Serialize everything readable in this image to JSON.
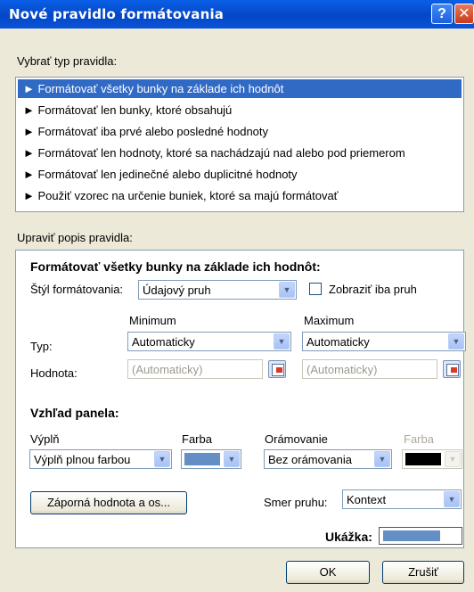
{
  "dialog": {
    "title": "Nové pravidlo formátovania",
    "help_glyph": "?",
    "close_glyph": "✕"
  },
  "rule_type": {
    "label": "Vybrať typ pravidla:",
    "items": [
      {
        "label": "► Formátovať všetky bunky na základe ich hodnôt",
        "selected": true
      },
      {
        "label": "► Formátovať len bunky, ktoré obsahujú",
        "selected": false
      },
      {
        "label": "► Formátovať iba prvé alebo posledné hodnoty",
        "selected": false
      },
      {
        "label": "► Formátovať len hodnoty, ktoré sa nachádzajú nad alebo pod priemerom",
        "selected": false
      },
      {
        "label": "► Formátovať len jedinečné alebo duplicitné hodnoty",
        "selected": false
      },
      {
        "label": "► Použiť vzorec na určenie buniek, ktoré sa majú formátovať",
        "selected": false
      }
    ]
  },
  "edit": {
    "label": "Upraviť popis pravidla:",
    "heading": "Formátovať všetky bunky na základe ich hodnôt:",
    "style_label": "Štýl formátovania:",
    "style_value": "Údajový pruh",
    "show_bar_only_label": "Zobraziť iba pruh",
    "show_bar_only_checked": false,
    "minimum_label": "Minimum",
    "maximum_label": "Maximum",
    "type_label": "Typ:",
    "value_label": "Hodnota:",
    "min_type": "Automaticky",
    "max_type": "Automaticky",
    "min_value": "(Automaticky)",
    "max_value": "(Automaticky)"
  },
  "bar": {
    "heading": "Vzhľad panela:",
    "fill_label": "Výplň",
    "fill_value": "Výplň plnou farbou",
    "color_label": "Farba",
    "fill_color": "#638ec6",
    "border_label": "Orámovanie",
    "border_value": "Bez orámovania",
    "border_color_label": "Farba",
    "border_color": "#000000",
    "negative_button": "Záporná hodnota a os...",
    "direction_label": "Smer pruhu:",
    "direction_value": "Kontext",
    "preview_label": "Ukážka:"
  },
  "buttons": {
    "ok": "OK",
    "cancel": "Zrušiť"
  },
  "icons": {
    "dropdown": "chevron-down-icon",
    "range_picker": "range-picker-icon"
  }
}
